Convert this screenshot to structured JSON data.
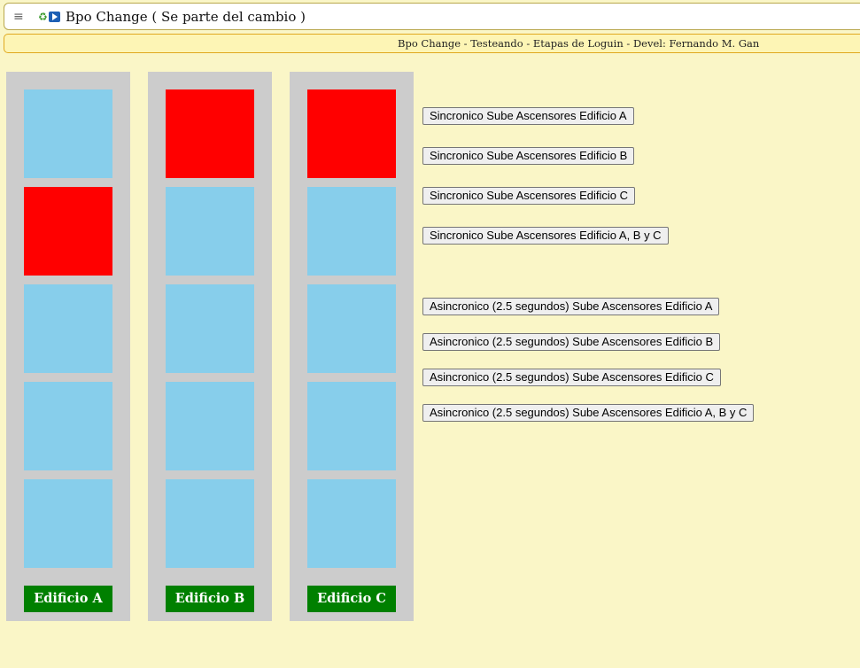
{
  "header": {
    "title": "Bpo Change ( Se parte del cambio )",
    "menu_icon": "≡",
    "logo_recycle": "♻"
  },
  "subheader": {
    "text": "Bpo Change - Testeando - Etapas de Loguin - Devel: Fernando M. Gan"
  },
  "colors": {
    "floor_idle": "#87ceeb",
    "floor_active": "#ff0000",
    "label_bg": "#008000",
    "shaft_bg": "#cccccc"
  },
  "buildings": [
    {
      "label": "Edificio A",
      "active_floor": 4
    },
    {
      "label": "Edificio B",
      "active_floor": 5
    },
    {
      "label": "Edificio C",
      "active_floor": 5
    }
  ],
  "floors_per_building": 5,
  "buttons": {
    "sync_a": "Sincronico Sube Ascensores Edificio A",
    "sync_b": "Sincronico Sube Ascensores Edificio B",
    "sync_c": "Sincronico Sube Ascensores Edificio C",
    "sync_abc": "Sincronico Sube Ascensores Edificio A, B y C",
    "async_a": "Asincronico (2.5 segundos) Sube Ascensores Edificio A",
    "async_b": "Asincronico (2.5 segundos) Sube Ascensores Edificio B",
    "async_c": "Asincronico (2.5 segundos) Sube Ascensores Edificio C",
    "async_abc": "Asincronico (2.5 segundos) Sube Ascensores Edificio A, B y C"
  }
}
